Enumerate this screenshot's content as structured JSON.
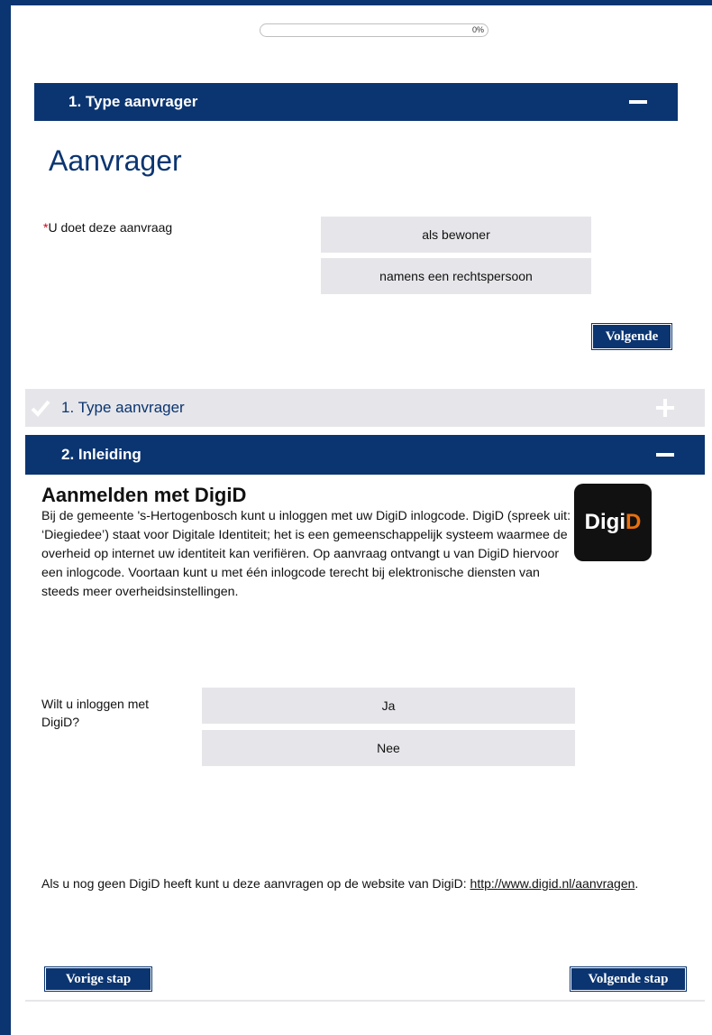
{
  "progress": {
    "percent": 0,
    "label": "0%"
  },
  "section1": {
    "title": "1. Type aanvrager"
  },
  "aanvrager": {
    "heading": "Aanvrager",
    "required_marker": "*",
    "question": "U doet deze aanvraag",
    "options": [
      "als bewoner",
      "namens een rechtspersoon"
    ],
    "next_label": "Volgende"
  },
  "section1_collapsed": {
    "title": "1. Type aanvrager"
  },
  "section2": {
    "title": "2. Inleiding"
  },
  "digid": {
    "heading": "Aanmelden met DigiD",
    "logo_text_white": "Dig",
    "logo_text_i": "i",
    "logo_text_orange": "D",
    "intro": "Bij de gemeente 's-Hertogenbosch kunt u inloggen met uw DigiD inlogcode. DigiD (spreek uit: ‘Diegiedee’) staat voor Digitale Identiteit; het is een gemeenschappelijk systeem waarmee de overheid op internet uw identiteit kan verifiëren. Op aanvraag ontvangt u van DigiD hiervoor een inlogcode. Voortaan kunt u met één inlogcode terecht bij elektronische diensten van steeds meer overheidsinstellingen.",
    "question": "Wilt u inloggen met DigiD?",
    "options": [
      "Ja",
      "Nee"
    ],
    "note_text": "Als u nog geen DigiD heeft kunt u deze aanvragen op de website van DigiD: ",
    "note_link": "http://www.digid.nl/aanvragen",
    "note_end": "."
  },
  "nav": {
    "prev_label": "Vorige stap",
    "next_label": "Volgende stap"
  },
  "colors": {
    "brand": "#0b3571",
    "option_bg": "#e6e6ea",
    "digid_orange": "#e8700e"
  }
}
